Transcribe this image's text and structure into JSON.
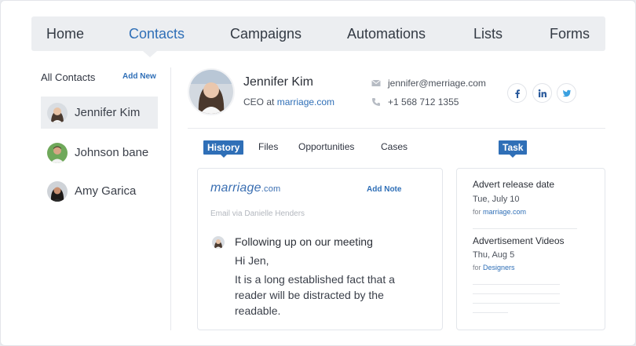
{
  "nav": {
    "items": [
      "Home",
      "Contacts",
      "Campaigns",
      "Automations",
      "Lists",
      "Forms"
    ],
    "active": "Contacts"
  },
  "sidebar": {
    "title": "All Contacts",
    "add_new": "Add New",
    "contacts": [
      {
        "name": "Jennifer Kim",
        "selected": true
      },
      {
        "name": "Johnson bane",
        "selected": false
      },
      {
        "name": "Amy Garica",
        "selected": false
      }
    ]
  },
  "profile": {
    "name": "Jennifer Kim",
    "role_prefix": "CEO at",
    "company": "marriage.com",
    "email": "jennifer@merriage.com",
    "phone": "+1 568 712 1355",
    "socials": [
      "facebook-icon",
      "linkedin-icon",
      "twitter-icon"
    ]
  },
  "tabs": {
    "items": [
      "History",
      "Files",
      "Opportunities",
      "Cases"
    ],
    "active": "History",
    "task_label": "Task"
  },
  "history": {
    "logo_main": "marriage",
    "logo_domain": ".com",
    "add_note": "Add Note",
    "via": "Email via Danielle Henders",
    "subject": "Following up on our meeting",
    "greeting": "Hi Jen,",
    "body": "It is a long established fact that a reader will be distracted by the readable."
  },
  "tasks": [
    {
      "title": "Advert release date",
      "date": "Tue, July 10",
      "for_label": "for",
      "for_value": "marriage.com"
    },
    {
      "title": "Advertisement Videos",
      "date": "Thu, Aug 5",
      "for_label": "for",
      "for_value": "Designers"
    }
  ],
  "colors": {
    "accent": "#2f6fb7",
    "nav_bg": "#eceef1"
  }
}
